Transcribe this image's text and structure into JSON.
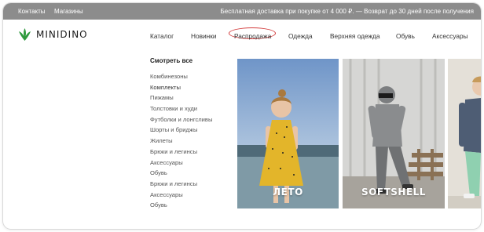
{
  "topbar": {
    "contacts": "Контакты",
    "stores": "Магазины",
    "promo": "Бесплатная доставка при покупке от 4 000 ₽. — Возврат до 30 дней после получения"
  },
  "logo": {
    "text": "MINIDINO"
  },
  "nav": {
    "items": [
      "Каталог",
      "Новинки",
      "Распродажа",
      "Одежда",
      "Верхняя одежда",
      "Обувь",
      "Аксессуары"
    ],
    "highlighted": "Распродажа"
  },
  "submenu": {
    "title": "Смотреть все",
    "items": [
      "Комбинезоны",
      "Комплекты",
      "Пижамы",
      "Толстовки и худи",
      "Футболки и лонгсливы",
      "Шорты и бриджы",
      "Жилеты",
      "Брюки и легинсы",
      "Аксессуары",
      "Обувь",
      "Брюки и легинсы",
      "Аксессуары",
      "Обувь"
    ]
  },
  "tiles": [
    {
      "caption": "ЛЕТО",
      "icon": "girl-yellow-dress-photo"
    },
    {
      "caption": "SOFTSHELL",
      "icon": "child-grey-softshell-photo"
    },
    {
      "caption": "",
      "icon": "boy-jacket-photo"
    }
  ],
  "colors": {
    "topbar": "#8c8c8c",
    "accent": "#2e9a3c",
    "sale_outline": "#d33b3b"
  }
}
